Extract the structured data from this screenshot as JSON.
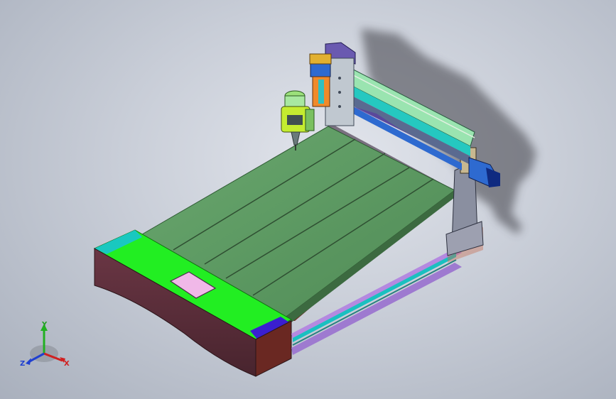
{
  "triad": {
    "x_label": "X",
    "y_label": "Y",
    "z_label": "Z"
  },
  "colors": {
    "background": "#c9ced8",
    "table_top": "#5f9a64",
    "end_cap_top": "#22ee22",
    "end_cap_side": "#5a2f3a",
    "control_panel": "#f0b8e8",
    "rail": "#1ac0c0",
    "motor": "#2e6ad0",
    "spindle": "#9be07a",
    "gantry_frame": "#8a7fd0",
    "column": "#8a8fa0"
  }
}
